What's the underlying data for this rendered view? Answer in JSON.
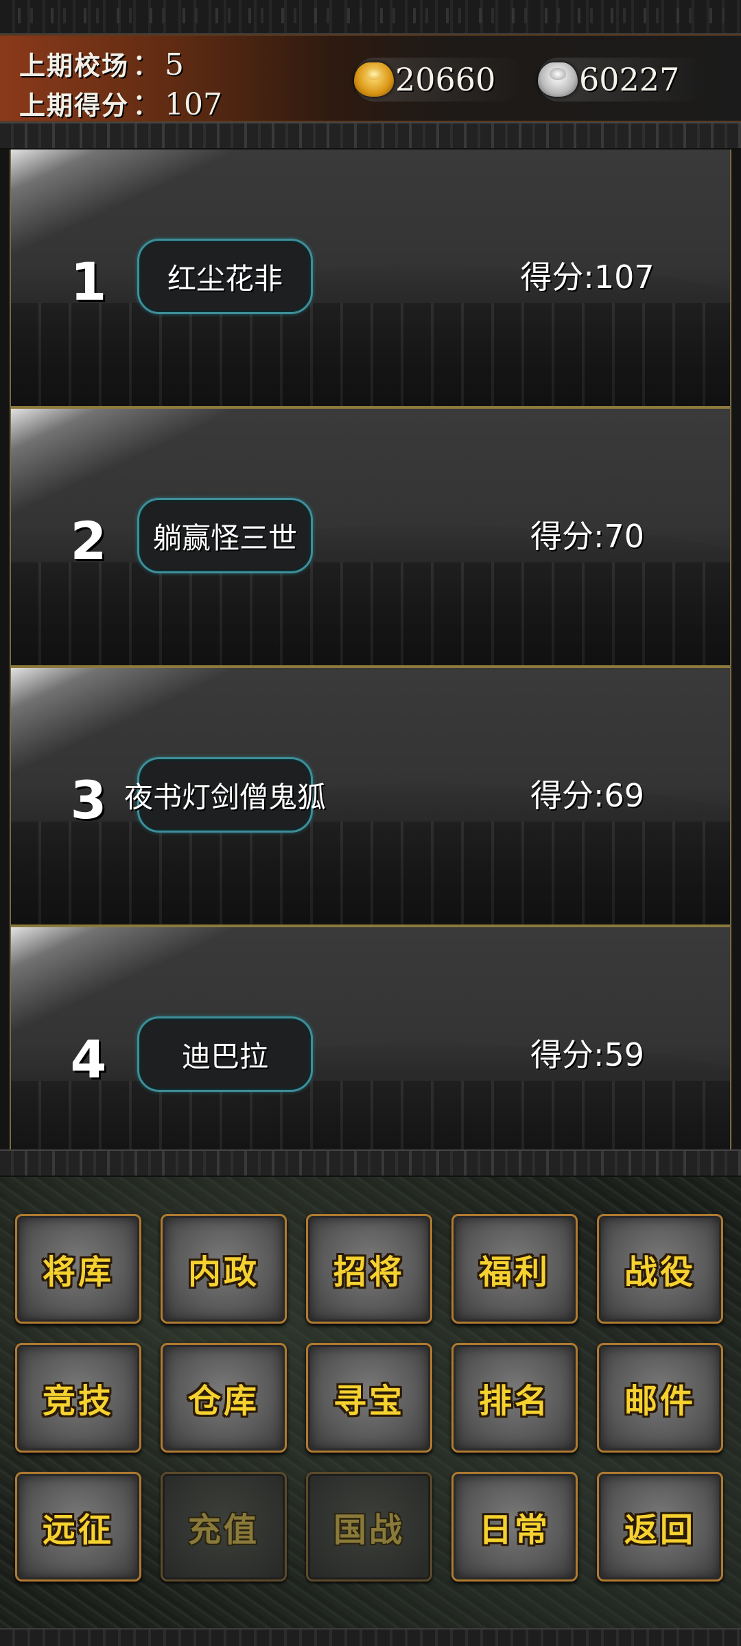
{
  "header": {
    "last_arena_label": "上期校场",
    "last_arena_sep": "：",
    "last_arena_value": "5",
    "last_score_label": "上期得分",
    "last_score_sep": "：",
    "last_score_value": "107",
    "gold_icon": "gold-ingot-icon",
    "gold_amount": "20660",
    "silver_icon": "silver-ingot-icon",
    "silver_amount": "60227"
  },
  "ranking": [
    {
      "rank": "1",
      "name": "红尘花非",
      "score": "得分:107"
    },
    {
      "rank": "2",
      "name": "躺赢怪三世",
      "score": "得分:70"
    },
    {
      "rank": "3",
      "name": "夜书灯剑僧鬼狐",
      "score": "得分:69"
    },
    {
      "rank": "4",
      "name": "迪巴拉",
      "score": "得分:59"
    }
  ],
  "menu": {
    "row1": [
      "将库",
      "内政",
      "招将",
      "福利",
      "战役"
    ],
    "row2": [
      "竞技",
      "仓库",
      "寻宝",
      "排名",
      "邮件"
    ],
    "row3": [
      "远征",
      "充值",
      "国战",
      "日常",
      "返回"
    ]
  },
  "colors": {
    "menu_label": "#f6d230",
    "menu_border": "#b07a30",
    "pill_border": "#3f8f99",
    "header_left": "#8a3a1a"
  }
}
